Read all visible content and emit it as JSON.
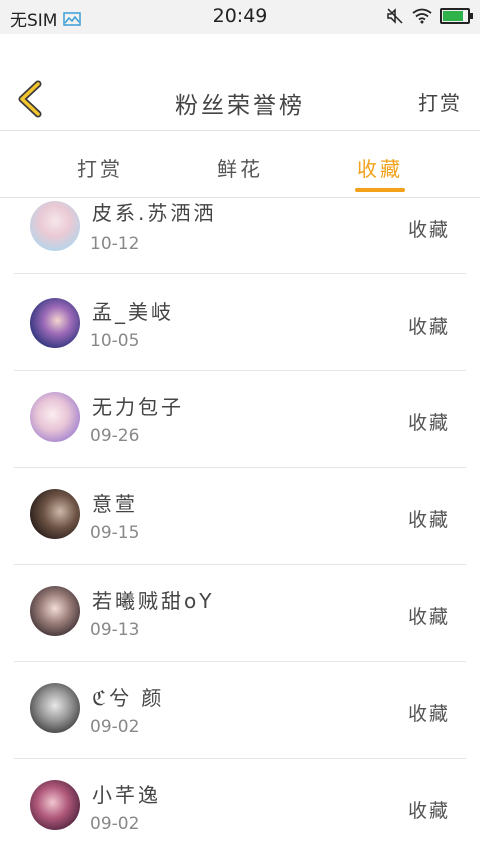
{
  "status_bar": {
    "carrier": "无SIM",
    "time": "20:49"
  },
  "header": {
    "title": "粉丝荣誉榜",
    "right_label": "打赏"
  },
  "tabs": [
    {
      "label": "打赏",
      "active": false
    },
    {
      "label": "鲜花",
      "active": false
    },
    {
      "label": "收藏",
      "active": true
    }
  ],
  "accent_color": "#f2a21a",
  "list": [
    {
      "name": "皮系.苏洒洒",
      "date": "10-12",
      "action": "收藏"
    },
    {
      "name": "孟_美岐",
      "date": "10-05",
      "action": "收藏"
    },
    {
      "name": "无力包子",
      "date": "09-26",
      "action": "收藏"
    },
    {
      "name": "意萱",
      "date": "09-15",
      "action": "收藏"
    },
    {
      "name": "若曦贼甜oY",
      "date": "09-13",
      "action": "收藏"
    },
    {
      "name": "ℭ兮 颜",
      "date": "09-02",
      "action": "收藏"
    },
    {
      "name": "小芊逸",
      "date": "09-02",
      "action": "收藏"
    }
  ]
}
